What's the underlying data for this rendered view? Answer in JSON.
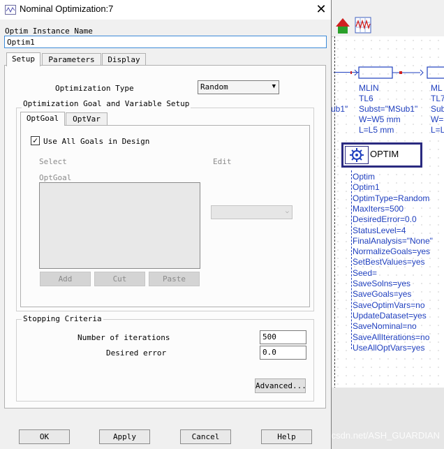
{
  "dialog": {
    "title": "Nominal Optimization:7",
    "close_label": "✕",
    "instance_label": "Optim Instance Name",
    "instance_value": "Optim1",
    "tabs": [
      {
        "label": "Setup",
        "active": true
      },
      {
        "label": "Parameters",
        "active": false
      },
      {
        "label": "Display",
        "active": false
      }
    ],
    "setup": {
      "optim_type_label": "Optimization Type",
      "optim_type_value": "Random",
      "goal_group_title": "Optimization Goal and Variable Setup",
      "inner_tabs": [
        {
          "label": "OptGoal",
          "active": true
        },
        {
          "label": "OptVar",
          "active": false
        }
      ],
      "use_all_goals_label": "Use All Goals in Design",
      "use_all_goals_checked": true,
      "select_label": "Select",
      "edit_label": "Edit",
      "optgoal_list_label": "OptGoal",
      "edit_dropdown_value": "",
      "add_label": "Add",
      "cut_label": "Cut",
      "paste_label": "Paste",
      "stopping_group_title": "Stopping Criteria",
      "iterations_label": "Number of iterations",
      "iterations_value": "500",
      "error_label": "Desired error",
      "error_value": "0.0",
      "advanced_label": "Advanced..."
    },
    "buttons": {
      "ok": "OK",
      "apply": "Apply",
      "cancel": "Cancel",
      "help": "Help"
    }
  },
  "schematic": {
    "mlin_label": "MLIN",
    "tl6": "TL6",
    "subst": "Subst=\"MSub1\"",
    "sub1_partial": "ub1\"",
    "width": "W=W5 mm",
    "length": "L=L5 mm",
    "mlin_partial": "ML",
    "tl7_partial": "TL7",
    "subst_partial": "Subst",
    "w_partial": "W=",
    "l_partial": "L=L",
    "optim_button_label": "OPTIM",
    "optim_params": [
      "Optim",
      "Optim1",
      "OptimType=Random",
      "MaxIters=500",
      "DesiredError=0.0",
      "StatusLevel=4",
      "FinalAnalysis=\"None\"",
      "NormalizeGoals=yes",
      "SetBestValues=yes",
      "Seed=",
      "SaveSolns=yes",
      "SaveGoals=yes",
      "SaveOptimVars=no",
      "UpdateDataset=yes",
      "SaveNominal=no",
      "SaveAllIterations=no",
      "UseAllOptVars=yes"
    ],
    "watermark": "https://blog.csdn.net/ASH_GUARDIAN"
  },
  "colors": {
    "accent": "#3c8ad8",
    "schematic_text": "#1f3fbf",
    "tool_green": "#2aa02a",
    "tool_red": "#d02020"
  }
}
